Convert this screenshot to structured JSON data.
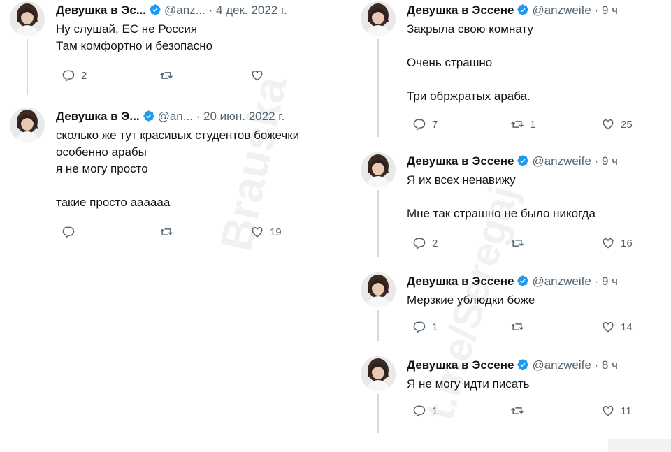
{
  "icons": {
    "reply": "reply-icon",
    "retweet": "retweet-icon",
    "like": "like-icon",
    "verified": "verified-badge-icon",
    "avatar": "avatar"
  },
  "colors": {
    "verified": "#1d9bf0",
    "muted": "#536471",
    "text": "#0f1419",
    "line": "#cfd9de"
  },
  "watermarks": {
    "left": "Brauska",
    "right": "t.me/Seregaj"
  },
  "left": [
    {
      "name": "Девушка в Эс...",
      "handle": "@anz...",
      "time": "4 дек. 2022 г.",
      "text": "Ну слушай, ЕС не Россия\nТам комфортно и безопасно",
      "replies": "2",
      "retweets": "",
      "likes": ""
    },
    {
      "name": "Девушка в Э...",
      "handle": "@an...",
      "time": "20 июн. 2022 г.",
      "text": "сколько же тут красивых студентов божечки\nособенно арабы\nя не могу просто\n\nтакие просто аааааа",
      "replies": "",
      "retweets": "",
      "likes": "19"
    }
  ],
  "right": [
    {
      "name": "Девушка в Эссене",
      "handle": "@anzweife",
      "time": "9 ч",
      "text": "Закрыла свою комнату\n\nОчень страшно\n\nТри обржратых араба.",
      "replies": "7",
      "retweets": "1",
      "likes": "25"
    },
    {
      "name": "Девушка в Эссене",
      "handle": "@anzweife",
      "time": "9 ч",
      "text": "Я их всех ненавижу\n\nМне так страшно не было никогда",
      "replies": "2",
      "retweets": "",
      "likes": "16"
    },
    {
      "name": "Девушка в Эссене",
      "handle": "@anzweife",
      "time": "9 ч",
      "text": "Мерзкие ублюдки боже",
      "replies": "1",
      "retweets": "",
      "likes": "14"
    },
    {
      "name": "Девушка в Эссене",
      "handle": "@anzweife",
      "time": "8 ч",
      "text": "Я не могу идти писать",
      "replies": "1",
      "retweets": "",
      "likes": "11"
    }
  ]
}
